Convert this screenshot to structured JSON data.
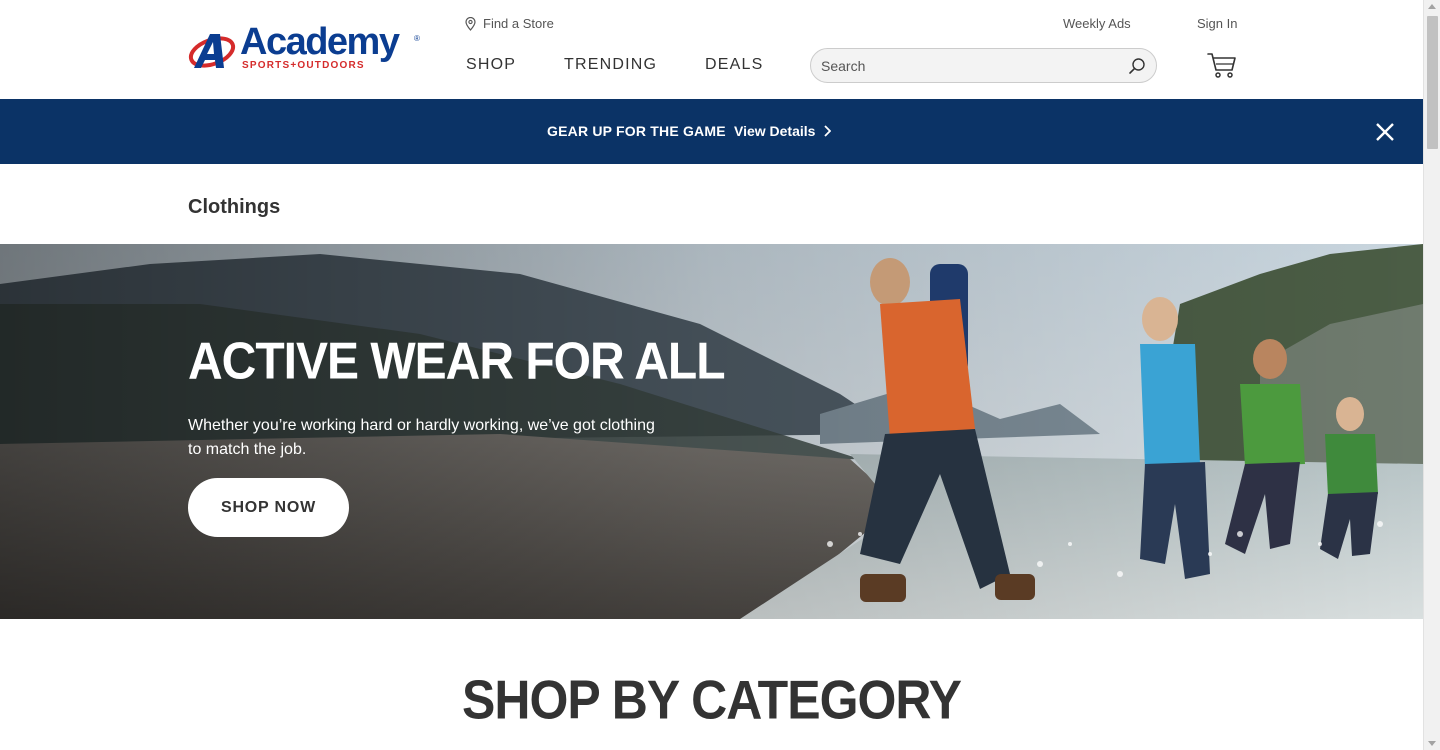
{
  "header": {
    "logo": {
      "name": "Academy",
      "tagline": "SPORTS+OUTDOORS",
      "reg": "®"
    },
    "find_store": "Find a Store",
    "weekly_ads": "Weekly Ads",
    "sign_in": "Sign In",
    "nav": {
      "shop": "SHOP",
      "trending": "TRENDING",
      "deals": "DEALS"
    },
    "search": {
      "placeholder": "Search",
      "value": ""
    },
    "icons": {
      "store": "location-pin-icon",
      "search": "search-icon",
      "cart": "cart-icon"
    }
  },
  "promo": {
    "text": "GEAR UP FOR THE GAME",
    "link": "View Details",
    "icons": {
      "link": "chevron-right-icon",
      "close": "close-icon"
    },
    "color": "#0b3366"
  },
  "page": {
    "title": "Clothings"
  },
  "hero": {
    "title": "ACTIVE WEAR FOR ALL",
    "subtitle": "Whether you’re working hard or hardly working, we’ve got clothing to match the job.",
    "button": "SHOP NOW"
  },
  "section": {
    "title": "SHOP BY CATEGORY"
  },
  "colors": {
    "brand_blue": "#0b3d91",
    "brand_red": "#d52b2b",
    "banner": "#0b3366"
  }
}
